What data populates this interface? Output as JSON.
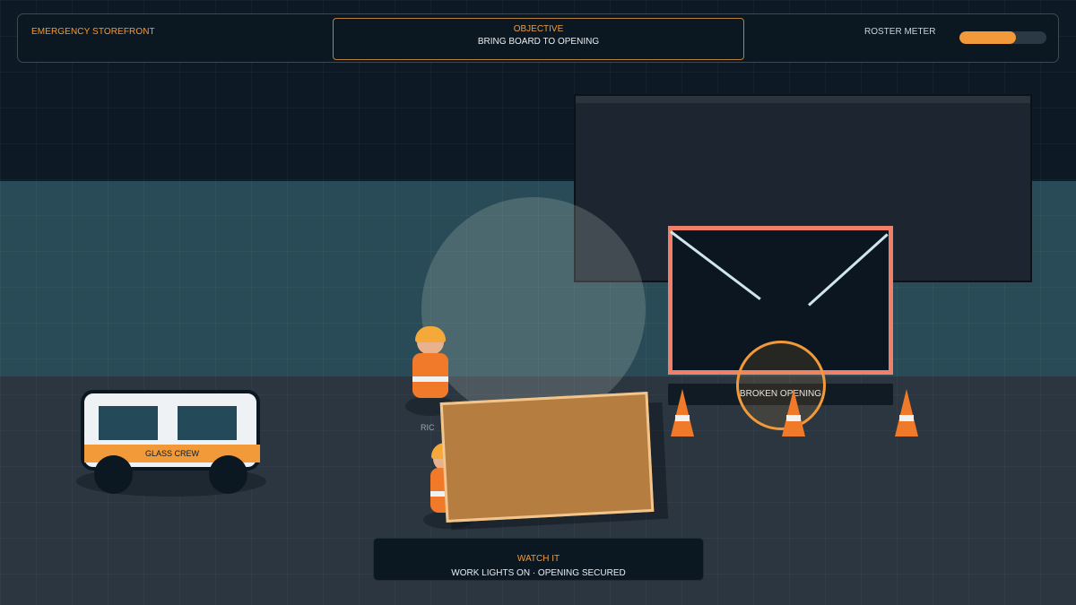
{
  "hud": {
    "brand": "EMERGENCY STOREFRONT",
    "objective_label": "OBJECTIVE",
    "objective_text": "BRING BOARD TO OPENING",
    "roster_label": "ROSTER METER",
    "roster_fill_percent": 65
  },
  "scene": {
    "opening_label": "BROKEN OPENING",
    "van_label": "GLASS CREW",
    "worker_name_partial": "RIC"
  },
  "status": {
    "label": "WATCH IT",
    "text": "WORK LIGHTS ON · OPENING SECURED"
  },
  "colors": {
    "accent": "#f29a3a",
    "opening_frame": "#f0806a",
    "board": "#b57d3f",
    "wall": "#284b57",
    "ground": "#2b3640"
  }
}
